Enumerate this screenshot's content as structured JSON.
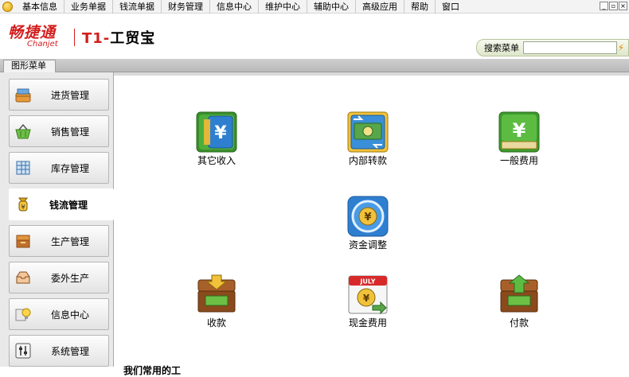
{
  "menubar": {
    "items": [
      "基本信息",
      "业务单据",
      "钱流单据",
      "财务管理",
      "信息中心",
      "维护中心",
      "辅助中心",
      "高级应用",
      "帮助",
      "窗口"
    ],
    "window_controls": [
      "_",
      "▫",
      "×"
    ]
  },
  "header": {
    "logo_cn": "畅捷通",
    "logo_en": "Chanjet",
    "product_prefix": "T1-",
    "product_name": "工贸宝"
  },
  "search": {
    "label": "搜索菜单",
    "value": "",
    "go_symbol": "⚡"
  },
  "tab": {
    "label": "图形菜单"
  },
  "sidebar": {
    "items": [
      {
        "label": "进货管理",
        "icon": "purchase-basket-icon",
        "active": false
      },
      {
        "label": "销售管理",
        "icon": "sales-basket-icon",
        "active": false
      },
      {
        "label": "库存管理",
        "icon": "inventory-grid-icon",
        "active": false
      },
      {
        "label": "钱流管理",
        "icon": "money-flow-icon",
        "active": true
      },
      {
        "label": "生产管理",
        "icon": "production-box-icon",
        "active": false
      },
      {
        "label": "委外生产",
        "icon": "outsourcing-tray-icon",
        "active": false
      },
      {
        "label": "信息中心",
        "icon": "info-lightbulb-icon",
        "active": false
      },
      {
        "label": "系统管理",
        "icon": "system-sliders-icon",
        "active": false
      }
    ]
  },
  "main": {
    "functions": [
      {
        "label": "其它收入",
        "icon": "other-income-icon"
      },
      {
        "label": "内部转款",
        "icon": "internal-transfer-icon"
      },
      {
        "label": "一般费用",
        "icon": "general-expense-icon"
      },
      {
        "label": "资金调整",
        "icon": "fund-adjust-icon"
      },
      {
        "label": "收款",
        "icon": "receipt-chest-icon"
      },
      {
        "label": "现金费用",
        "icon": "cash-expense-calendar-icon"
      },
      {
        "label": "付款",
        "icon": "payment-chest-icon"
      }
    ],
    "icon_text": {
      "yen": "¥",
      "calendar_month": "JULY"
    },
    "bottom_note": "我们常用的工"
  },
  "colors": {
    "brand_red": "#d41e1e",
    "icon_green": "#3d9a2e",
    "icon_blue": "#2f7fd0",
    "chest_brown": "#8a4a1c"
  }
}
